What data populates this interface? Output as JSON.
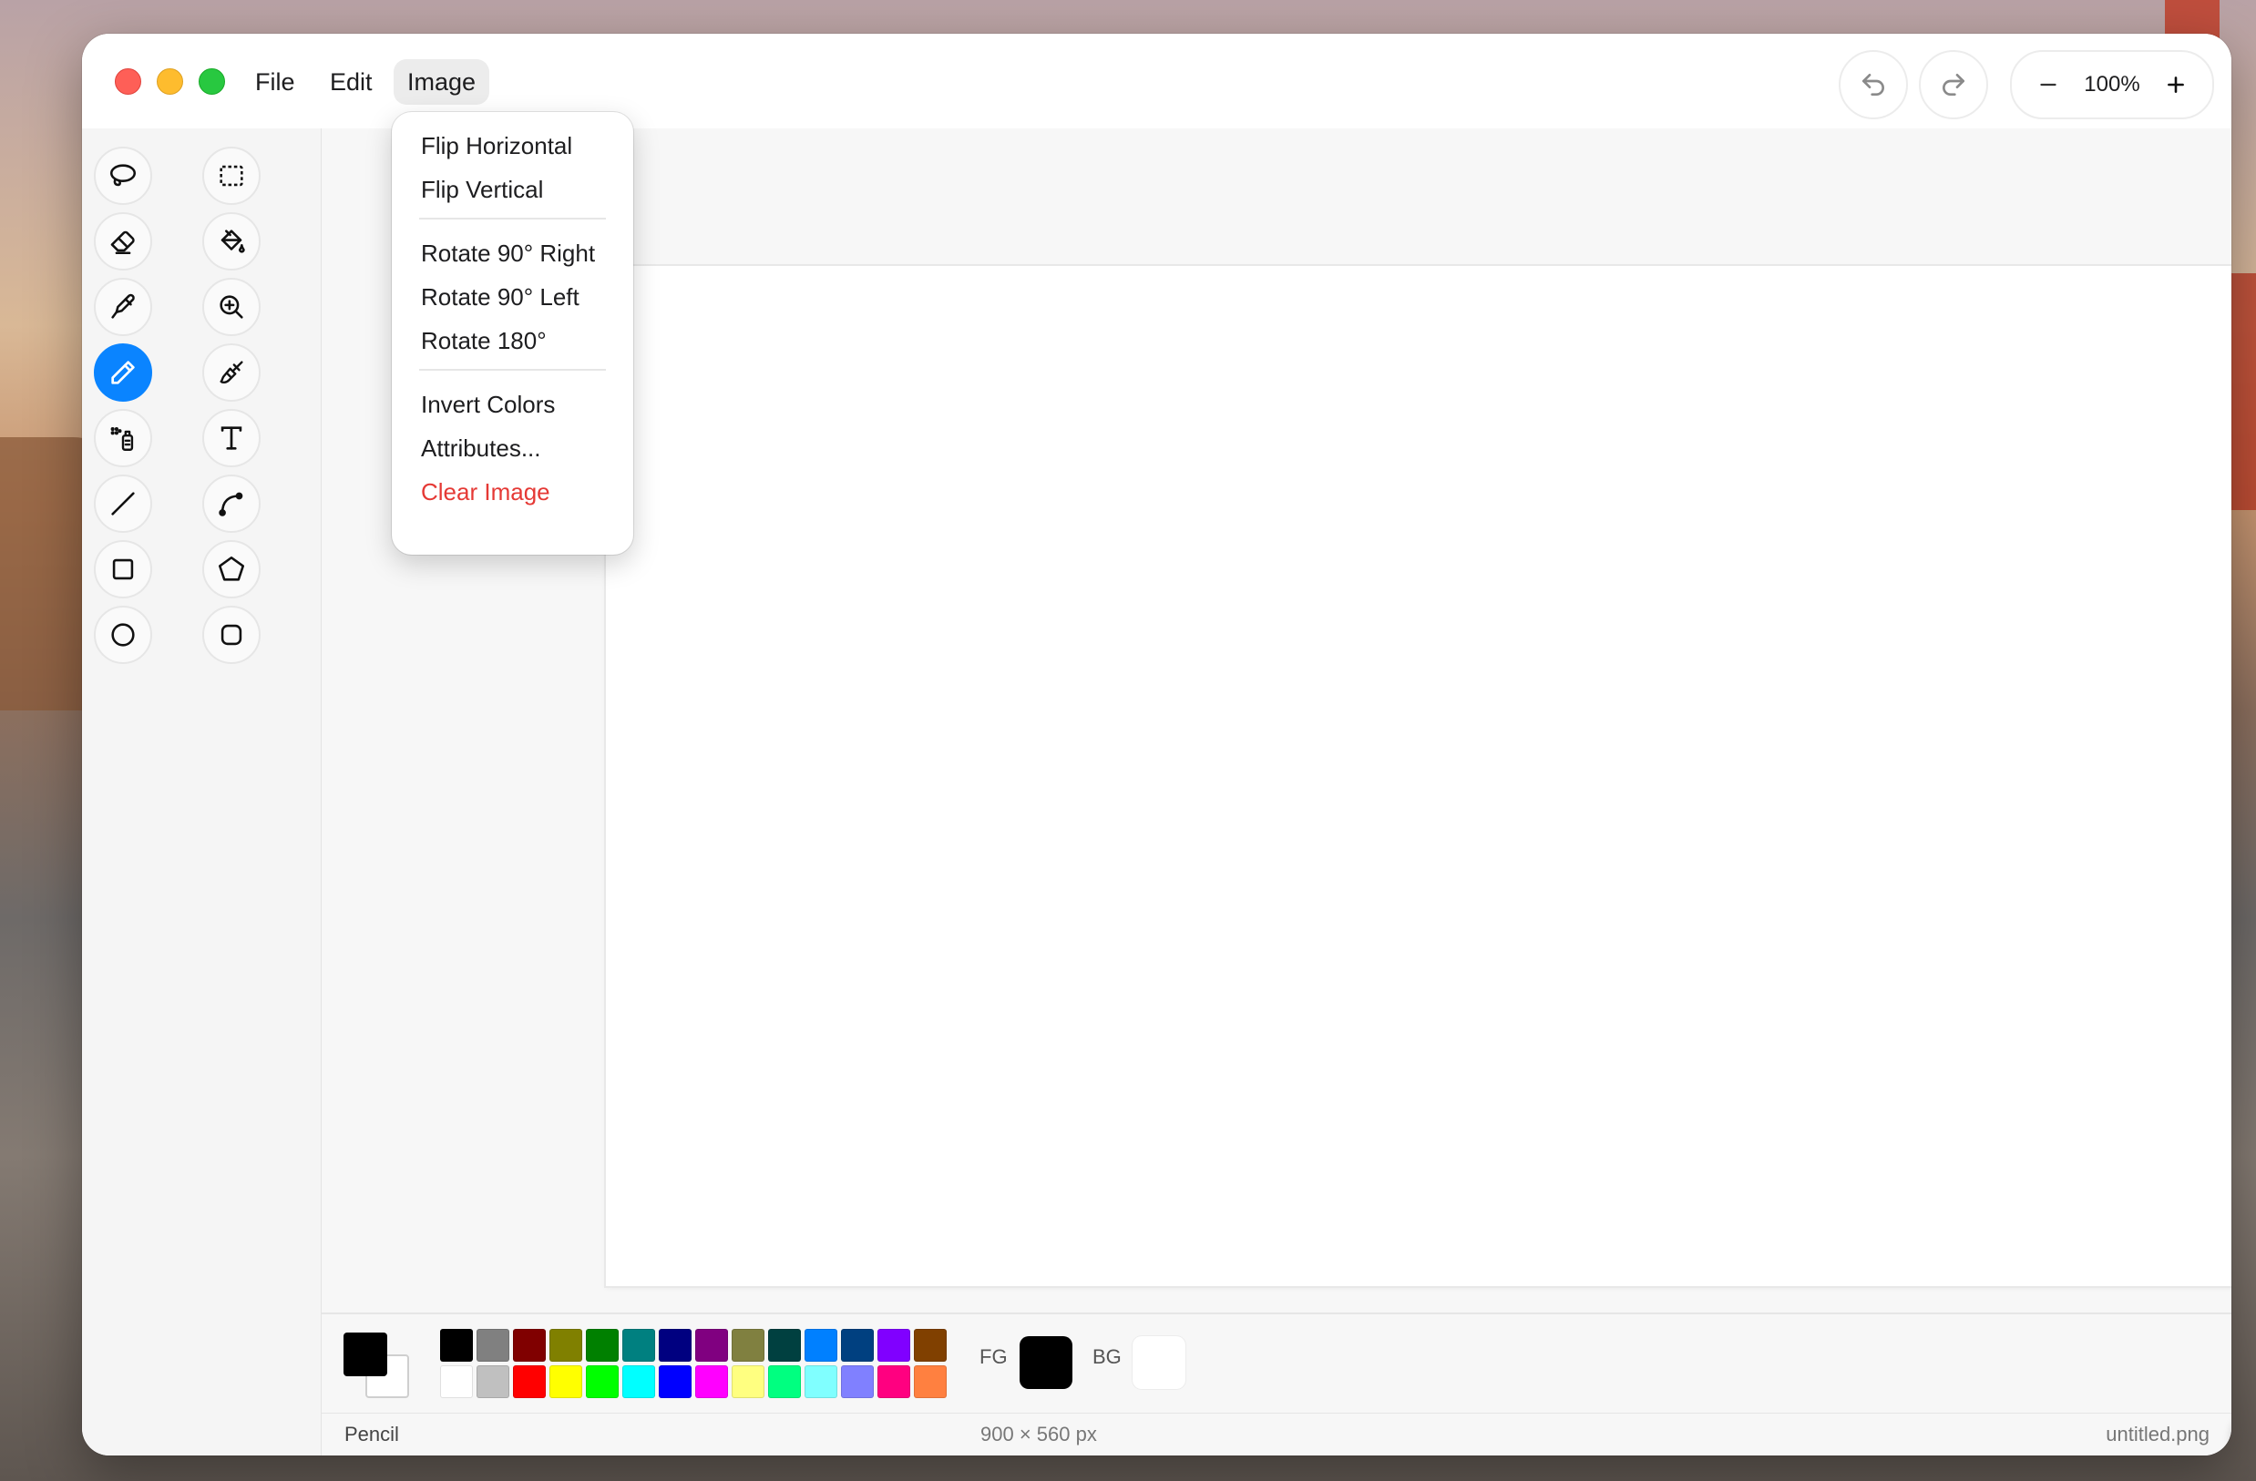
{
  "menubar": {
    "file": "File",
    "edit": "Edit",
    "image": "Image"
  },
  "zoom": {
    "value": "100%"
  },
  "image_menu": {
    "items": [
      "Flip Horizontal",
      "Flip Vertical",
      "Rotate 90° Right",
      "Rotate 90° Left",
      "Rotate 180°",
      "Invert Colors",
      "Attributes...",
      "Clear Image"
    ]
  },
  "tools": {
    "active": "pencil",
    "left_column": [
      "lasso",
      "eraser",
      "eyedropper",
      "pencil",
      "airbrush",
      "line",
      "rectangle",
      "ellipse"
    ],
    "right_column": [
      "rect-select",
      "fill-bucket",
      "magnifier",
      "brush",
      "text",
      "curve",
      "polygon",
      "rounded-rectangle"
    ]
  },
  "palette": {
    "row1": [
      "#000000",
      "#808080",
      "#800000",
      "#808000",
      "#008000",
      "#008080",
      "#000080",
      "#800080",
      "#808040",
      "#004040",
      "#0080ff",
      "#004080",
      "#8000ff",
      "#804000"
    ],
    "row2": [
      "#ffffff",
      "#c0c0c0",
      "#ff0000",
      "#ffff00",
      "#00ff00",
      "#00ffff",
      "#0000ff",
      "#ff00ff",
      "#ffff80",
      "#00ff80",
      "#80ffff",
      "#8080ff",
      "#ff0080",
      "#ff8040"
    ],
    "fg_label": "FG",
    "bg_label": "BG",
    "fg_color": "#000000",
    "bg_color": "#ffffff"
  },
  "status": {
    "tool": "Pencil",
    "size": "900 × 560 px",
    "file": "untitled.png"
  },
  "colors": {
    "accent": "#0a84ff",
    "danger": "#e53935"
  }
}
